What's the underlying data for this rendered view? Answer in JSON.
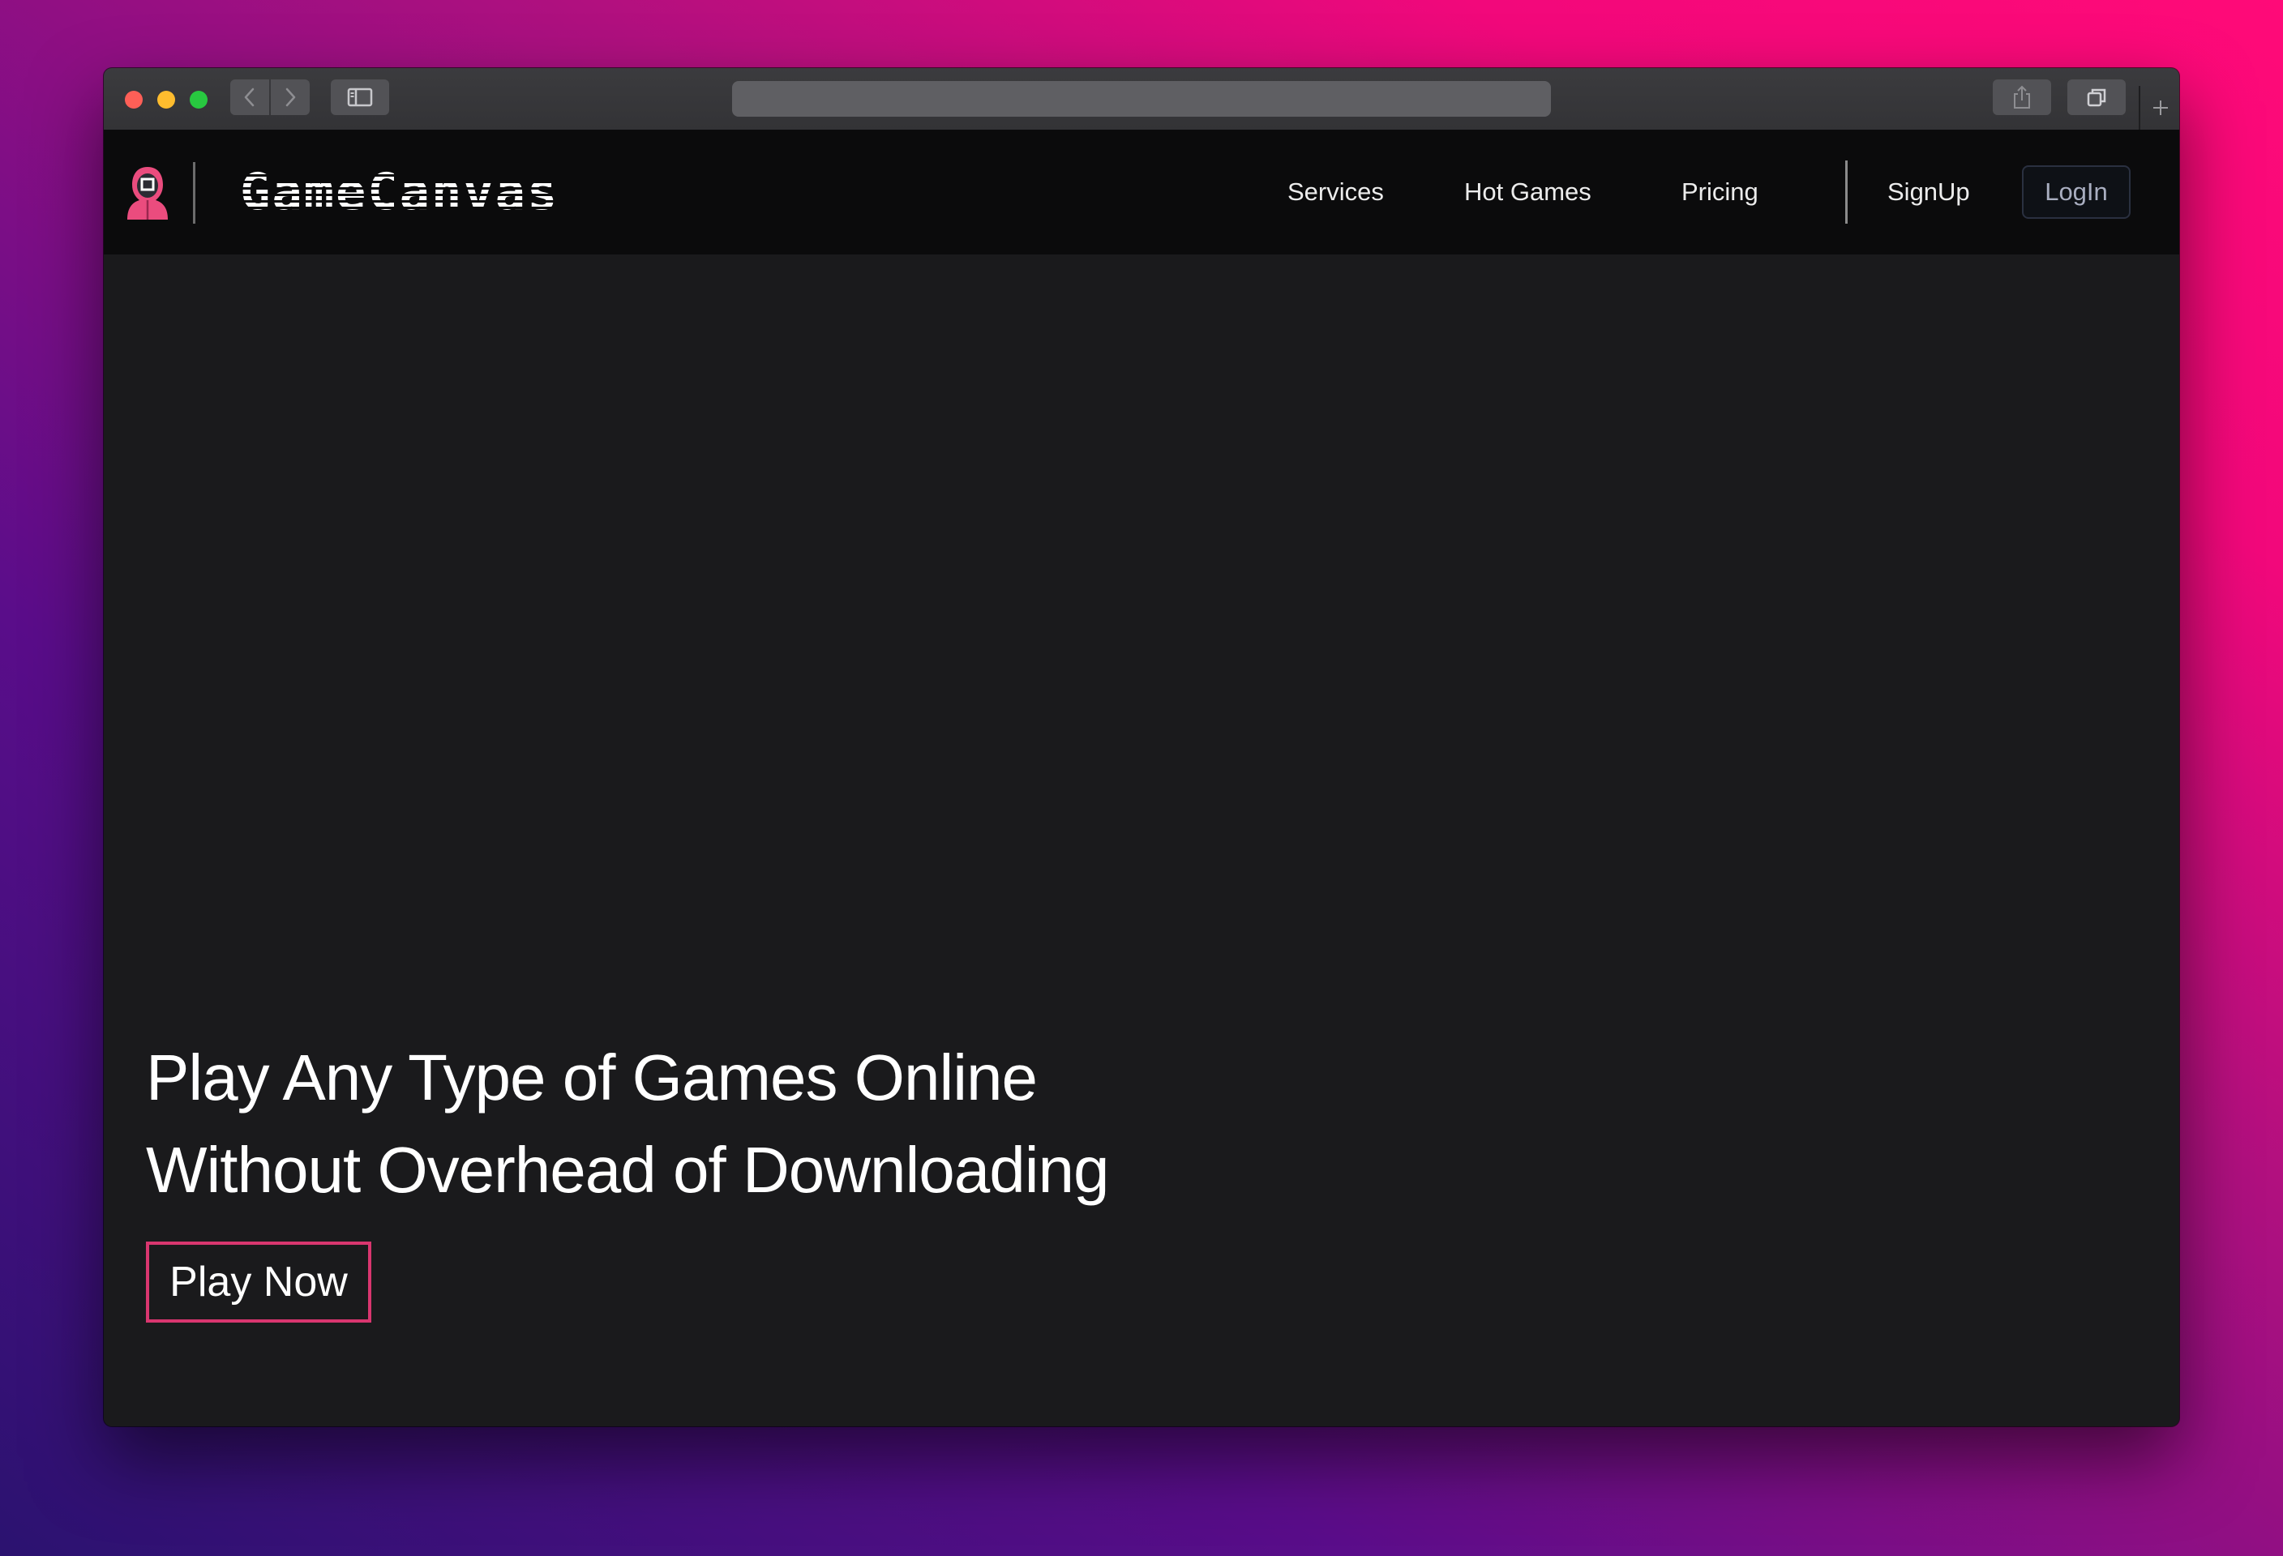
{
  "browser": {
    "traffic_lights": [
      "close",
      "minimize",
      "zoom"
    ],
    "icons": {
      "back": "chevron-left-icon",
      "forward": "chevron-right-icon",
      "sidebar": "sidebar-icon",
      "share": "share-icon",
      "tabs": "tabs-icon",
      "new_tab": "plus-icon"
    },
    "address": ""
  },
  "navbar": {
    "brand_name": "GameCanvas",
    "brand_icon": "hooded-guard-icon",
    "links": {
      "services": "Services",
      "hot_games": "Hot Games",
      "pricing": "Pricing",
      "signup": "SignUp",
      "login": "LogIn"
    }
  },
  "hero": {
    "line1": "Play Any Type of Games Online",
    "line2": "Without Overhead of Downloading",
    "cta": "Play Now"
  },
  "colors": {
    "accent": "#d9366f",
    "page_background": "#1a1a1c",
    "navbar_background": "#0b0b0c",
    "text": "#ffffff"
  }
}
